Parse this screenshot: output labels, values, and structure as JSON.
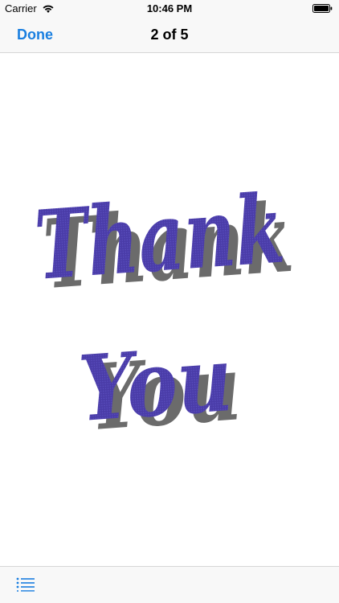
{
  "status_bar": {
    "carrier": "Carrier",
    "time": "10:46 PM",
    "icons": [
      "wifi-icon",
      "battery-icon"
    ]
  },
  "nav_bar": {
    "done_label": "Done",
    "title": "2 of 5"
  },
  "content": {
    "artwork_lines": [
      "Thank",
      "You"
    ],
    "fill_color": "#4a3ca8",
    "shadow_color": "#6b6b6b"
  },
  "toolbar": {
    "icons": [
      "list-icon"
    ]
  },
  "colors": {
    "accent": "#1a7fe0",
    "bar_background": "#f8f8f8"
  }
}
